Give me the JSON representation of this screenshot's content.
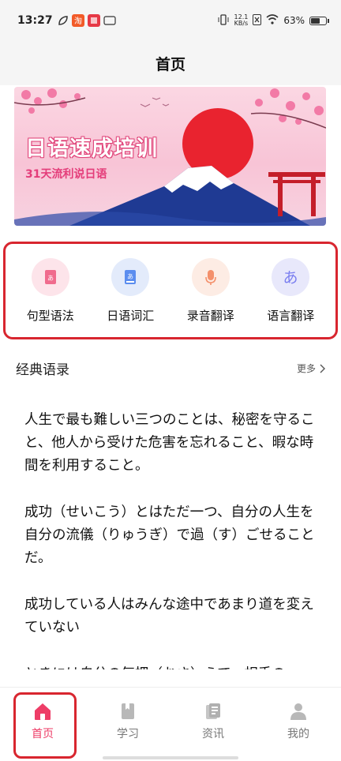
{
  "status_bar": {
    "time": "13:27",
    "net_speed_value": "12.1",
    "net_speed_unit": "KB/s",
    "battery": "63%",
    "battery_level": 0.63
  },
  "header": {
    "title": "首页"
  },
  "banner": {
    "title": "日语速成培训",
    "subtitle": "31天流利说日语"
  },
  "features": [
    {
      "label": "句型语法",
      "icon": "grammar-book-icon",
      "color": "#f06b8d",
      "bg": "#fde4ea"
    },
    {
      "label": "日语词汇",
      "icon": "vocabulary-book-icon",
      "color": "#5b8def",
      "bg": "#e3ebfb"
    },
    {
      "label": "录音翻译",
      "icon": "microphone-icon",
      "color": "#f4906b",
      "bg": "#fdece4"
    },
    {
      "label": "语言翻译",
      "icon": "hiragana-a-icon",
      "color": "#7a7ef0",
      "bg": "#e8e8fb"
    }
  ],
  "quotes_section": {
    "title": "经典语录",
    "more": "更多",
    "items": [
      "人生で最も難しい三つのことは、秘密を守ること、他人から受けた危害を忘れること、暇な時間を利用すること。",
      "成功（せいこう）とはただ一つ、自分の人生を自分の流儀（りゅうぎ）で過（す）ごせることだ。",
      "成功している人はみんな途中であまり道を変えていない",
      "ときには自分の気把（おさ）えて、相手の"
    ]
  },
  "tab_bar": {
    "tabs": [
      {
        "label": "首页",
        "icon": "home-icon",
        "active": true
      },
      {
        "label": "学习",
        "icon": "book-icon",
        "active": false
      },
      {
        "label": "资讯",
        "icon": "news-icon",
        "active": false
      },
      {
        "label": "我的",
        "icon": "profile-icon",
        "active": false
      }
    ]
  },
  "colors": {
    "accent": "#ee3d67",
    "highlight_border": "#d8262f"
  }
}
